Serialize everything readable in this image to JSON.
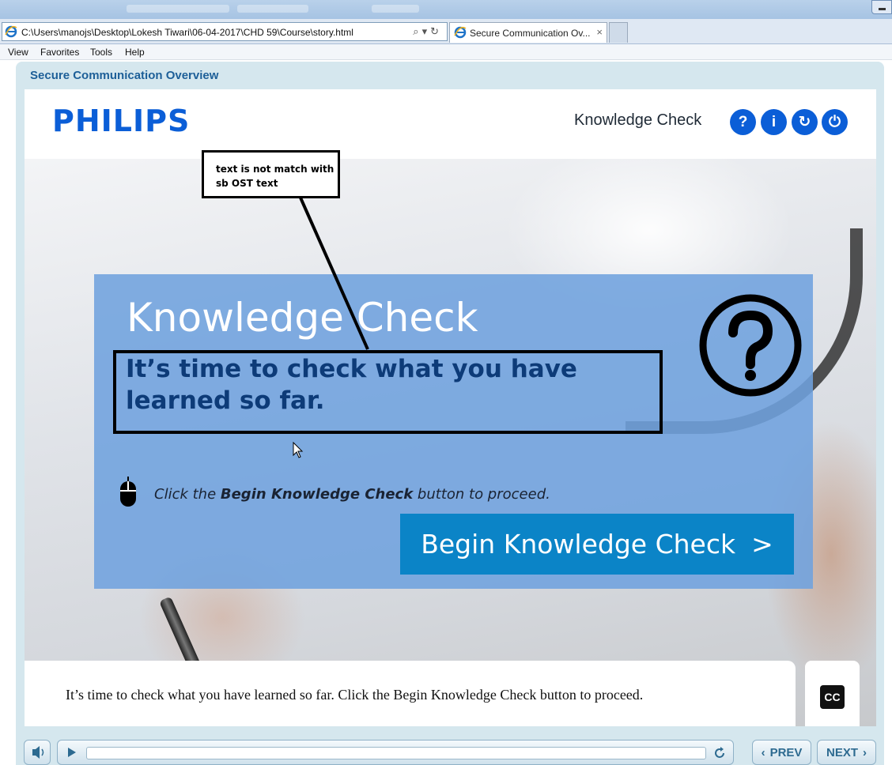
{
  "browser": {
    "address": "C:\\Users\\manojs\\Desktop\\Lokesh Tiwari\\06-04-2017\\CHD 59\\Course\\story.html",
    "tab_title": "Secure Communication Ov...",
    "tab_close": "×",
    "menu": [
      "View",
      "Favorites",
      "Tools",
      "Help"
    ]
  },
  "course": {
    "title": "Secure Communication Overview"
  },
  "header": {
    "logo": "PHILIPS",
    "section_title": "Knowledge Check",
    "buttons": [
      "?",
      "i",
      "↻",
      "⏻"
    ]
  },
  "panel": {
    "title": "Knowledge Check",
    "subtitle": "It’s time to check what you have learned so far.",
    "instruction_pre": "Click the ",
    "instruction_bold": "Begin Knowledge Check",
    "instruction_post": " button to proceed.",
    "begin_label": "Begin Knowledge Check",
    "begin_chevron": ">"
  },
  "caption": {
    "text": "It’s time to check what you have learned so far. Click the Begin Knowledge Check button to proceed.",
    "cc_label": "CC"
  },
  "annotation": {
    "text_line1": "text is not match with",
    "text_line2": "sb OST text"
  },
  "controls": {
    "prev_label": "PREV",
    "next_label": "NEXT",
    "prev_chevron": "‹",
    "next_chevron": "›",
    "progress": 0
  },
  "colors": {
    "brand_blue": "#0b5ed7",
    "panel_blue": "#6fa2de",
    "button_blue": "#0b84c7",
    "subtitle_navy": "#0d3b78"
  }
}
